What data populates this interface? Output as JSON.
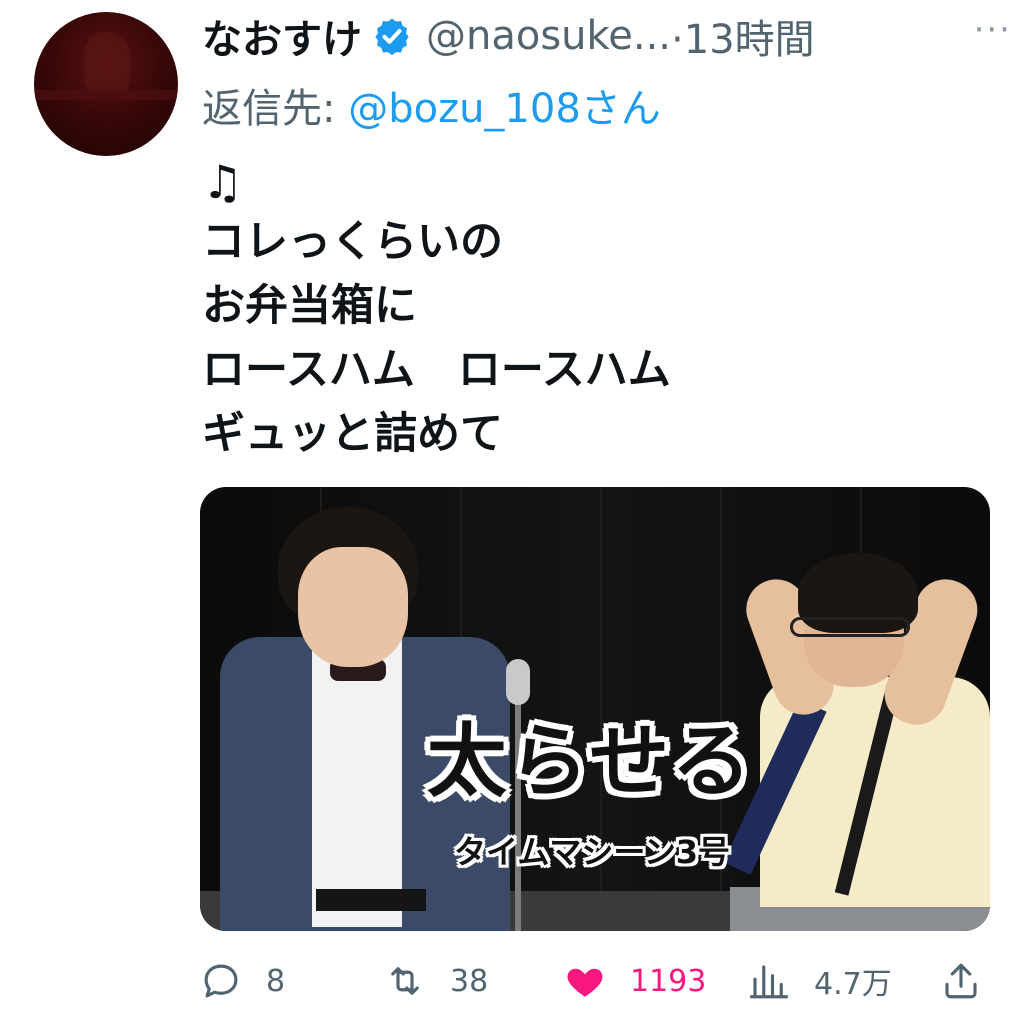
{
  "tweet": {
    "author_name": "なおすけ",
    "author_handle": "@naosuke...",
    "time": "·13時間",
    "more": "···",
    "reply_label": "返信先: ",
    "reply_mention": "@bozu_108さん",
    "note": "♫",
    "lines": [
      "コレっくらいの",
      "お弁当箱に",
      "ロースハム　ロースハム",
      "ギュッと詰めて"
    ],
    "media": {
      "title": "太らせる",
      "subtitle": "タイムマシーン3号"
    },
    "actions": {
      "replies": "8",
      "retweets": "38",
      "likes": "1193",
      "views": "4.7万"
    }
  },
  "colors": {
    "accent": "#1d9bf0",
    "like": "#f91880",
    "secondary": "#536471"
  },
  "icons": [
    "verified-badge-icon",
    "more-icon",
    "reply-icon",
    "retweet-icon",
    "like-icon",
    "views-icon",
    "share-icon"
  ]
}
